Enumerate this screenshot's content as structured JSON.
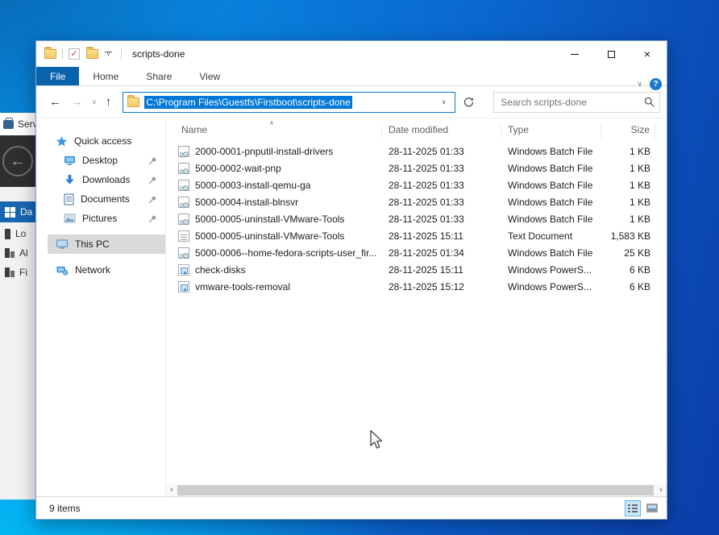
{
  "background_window": {
    "app_title_fragment": "Serv",
    "nav_items": [
      {
        "label": "Da",
        "active": true
      },
      {
        "label": "Lo",
        "active": false
      },
      {
        "label": "Al",
        "active": false
      },
      {
        "label": "Fi",
        "active": false
      }
    ]
  },
  "explorer": {
    "title": "scripts-done",
    "tabs": [
      {
        "label": "File",
        "active": true
      },
      {
        "label": "Home",
        "active": false
      },
      {
        "label": "Share",
        "active": false
      },
      {
        "label": "View",
        "active": false
      }
    ],
    "toolbar": {
      "path": "C:\\Program Files\\Guestfs\\Firstboot\\scripts-done",
      "search_placeholder": "Search scripts-done"
    },
    "sidebar": {
      "quick_access": "Quick access",
      "pinned": [
        "Desktop",
        "Downloads",
        "Documents",
        "Pictures"
      ],
      "this_pc": "This PC",
      "network": "Network"
    },
    "list": {
      "columns": [
        "Name",
        "Date modified",
        "Type",
        "Size"
      ],
      "sort": {
        "column": "Name",
        "direction": "asc"
      },
      "files": [
        {
          "name": "2000-0001-pnputil-install-drivers",
          "date": "28-11-2025 01:33",
          "type": "Windows Batch File",
          "size": "1 KB",
          "icon": "batch"
        },
        {
          "name": "5000-0002-wait-pnp",
          "date": "28-11-2025 01:33",
          "type": "Windows Batch File",
          "size": "1 KB",
          "icon": "batch"
        },
        {
          "name": "5000-0003-install-qemu-ga",
          "date": "28-11-2025 01:33",
          "type": "Windows Batch File",
          "size": "1 KB",
          "icon": "batch"
        },
        {
          "name": "5000-0004-install-blnsvr",
          "date": "28-11-2025 01:33",
          "type": "Windows Batch File",
          "size": "1 KB",
          "icon": "batch"
        },
        {
          "name": "5000-0005-uninstall-VMware-Tools",
          "date": "28-11-2025 01:33",
          "type": "Windows Batch File",
          "size": "1 KB",
          "icon": "batch"
        },
        {
          "name": "5000-0005-uninstall-VMware-Tools",
          "date": "28-11-2025 15:11",
          "type": "Text Document",
          "size": "1,583 KB",
          "icon": "textdoc"
        },
        {
          "name": "5000-0006--home-fedora-scripts-user_fir...",
          "date": "28-11-2025 01:34",
          "type": "Windows Batch File",
          "size": "25 KB",
          "icon": "batch"
        },
        {
          "name": "check-disks",
          "date": "28-11-2025 15:11",
          "type": "Windows PowerS...",
          "size": "6 KB",
          "icon": "ps"
        },
        {
          "name": "vmware-tools-removal",
          "date": "28-11-2025 15:12",
          "type": "Windows PowerS...",
          "size": "6 KB",
          "icon": "ps"
        }
      ]
    },
    "status_bar": {
      "items_count": "9 items"
    }
  },
  "icons": {
    "back": "←",
    "forward": "→",
    "up": "↑",
    "chevron_down": "∨",
    "close": "×",
    "check": "✓",
    "star": "★",
    "scroll_left": "‹",
    "scroll_right": "›",
    "help": "?"
  }
}
